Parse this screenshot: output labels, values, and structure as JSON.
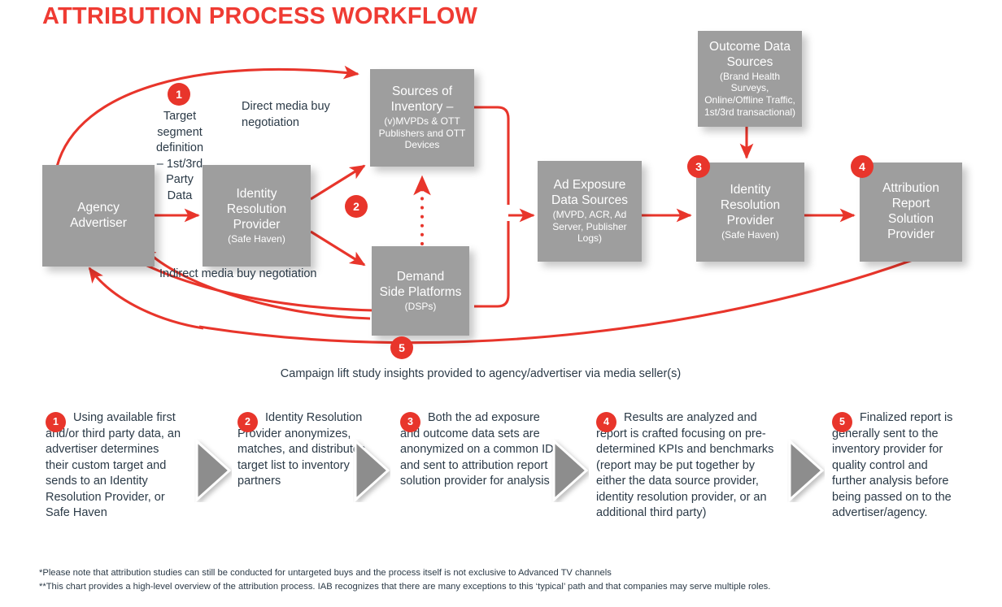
{
  "title": "ATTRIBUTION PROCESS WORKFLOW",
  "colors": {
    "accent": "#e8352b",
    "title": "#ef3b33",
    "box": "#9e9e9e",
    "text": "#2b3a47"
  },
  "boxes": {
    "agency": {
      "lines": [
        "Agency",
        "Advertiser"
      ]
    },
    "identity1": {
      "lines": [
        "Identity",
        "Resolution",
        "Provider"
      ],
      "sub": "(Safe Haven)"
    },
    "inventory": {
      "lines": [
        "Sources of",
        "Inventory –"
      ],
      "sub_lines": [
        "(v)MVPDs & OTT",
        "Publishers and OTT",
        "Devices"
      ]
    },
    "dsp": {
      "lines": [
        "Demand",
        "Side Platforms"
      ],
      "sub": "(DSPs)"
    },
    "outcome": {
      "lines": [
        "Outcome Data",
        "Sources"
      ],
      "sub_lines": [
        "(Brand Health Surveys,",
        "Online/Offline Traffic,",
        "1st/3rd transactional)"
      ]
    },
    "adexposure": {
      "lines": [
        "Ad Exposure",
        "Data Sources"
      ],
      "sub_lines": [
        "(MVPD, ACR, Ad",
        "Server, Publisher",
        "Logs)"
      ]
    },
    "identity2": {
      "lines": [
        "Identity",
        "Resolution",
        "Provider"
      ],
      "sub": "(Safe Haven)"
    },
    "attribution": {
      "lines": [
        "Attribution",
        "Report",
        "Solution",
        "Provider"
      ]
    }
  },
  "diagram_labels": {
    "target_segment": "Target\nsegment\ndefinition\n– 1st/3rd\nParty\nData",
    "direct_media": "Direct media buy\nnegotiation",
    "indirect_media": "Indirect media buy negotiation",
    "campaign_lift": "Campaign lift study insights provided to agency/advertiser via media seller(s)"
  },
  "diagram_step_badges": [
    "1",
    "2",
    "3",
    "4",
    "5"
  ],
  "steps": [
    {
      "num": "1",
      "text": "Using available first and/or third party data, an advertiser determines their custom target and sends to an Identity Resolution Provider, or Safe Haven"
    },
    {
      "num": "2",
      "text": "Identity Resolution Provider anonymizes, matches, and distributes target list to inventory partners"
    },
    {
      "num": "3",
      "text": "Both the ad exposure and outcome data sets are anonymized on a common ID and sent to attribution report solution provider for analysis"
    },
    {
      "num": "4",
      "text": "Results are analyzed and report is crafted focusing on pre-determined KPIs and benchmarks (report may be put together by either the data source provider, identity resolution provider, or an additional third party)"
    },
    {
      "num": "5",
      "text": "Finalized report is generally sent to the inventory provider for quality control and further analysis before being passed on to the advertiser/agency."
    }
  ],
  "footnotes": [
    "*Please note that attribution studies can still be conducted for untargeted buys and the process itself is not exclusive to Advanced TV channels",
    "**This chart provides a high-level overview of the attribution process. IAB recognizes that there are many exceptions to this ‘typical’ path and that companies may serve multiple roles."
  ]
}
